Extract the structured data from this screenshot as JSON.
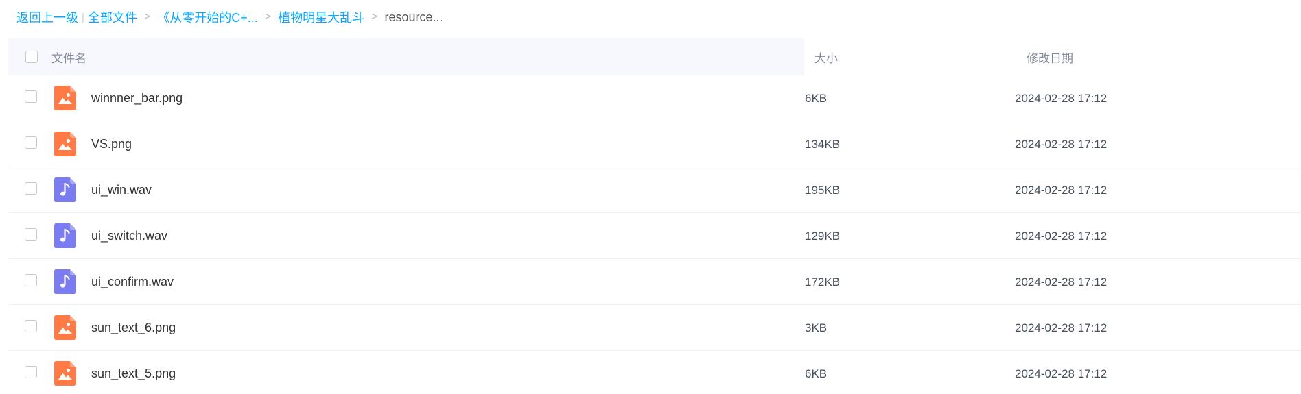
{
  "breadcrumb": {
    "back": "返回上一级",
    "separator_bar": "|",
    "all_files": "全部文件",
    "separator": ">",
    "folder_1": "《从零开始的C+...",
    "folder_2": "植物明星大乱斗",
    "current": "resource..."
  },
  "table": {
    "headers": {
      "name": "文件名",
      "size": "大小",
      "date": "修改日期"
    },
    "rows": [
      {
        "name": "winnner_bar.png",
        "size": "6KB",
        "date": "2024-02-28 17:12",
        "type": "image",
        "icon": "image-file-icon"
      },
      {
        "name": "VS.png",
        "size": "134KB",
        "date": "2024-02-28 17:12",
        "type": "image",
        "icon": "image-file-icon"
      },
      {
        "name": "ui_win.wav",
        "size": "195KB",
        "date": "2024-02-28 17:12",
        "type": "audio",
        "icon": "audio-file-icon"
      },
      {
        "name": "ui_switch.wav",
        "size": "129KB",
        "date": "2024-02-28 17:12",
        "type": "audio",
        "icon": "audio-file-icon"
      },
      {
        "name": "ui_confirm.wav",
        "size": "172KB",
        "date": "2024-02-28 17:12",
        "type": "audio",
        "icon": "audio-file-icon"
      },
      {
        "name": "sun_text_6.png",
        "size": "3KB",
        "date": "2024-02-28 17:12",
        "type": "image",
        "icon": "image-file-icon"
      },
      {
        "name": "sun_text_5.png",
        "size": "6KB",
        "date": "2024-02-28 17:12",
        "type": "image",
        "icon": "image-file-icon"
      }
    ]
  },
  "colors": {
    "link": "#06a7ff",
    "image_icon": "#ff7a45",
    "audio_icon": "#7b7cf2",
    "header_bg": "#f6f8fd"
  }
}
